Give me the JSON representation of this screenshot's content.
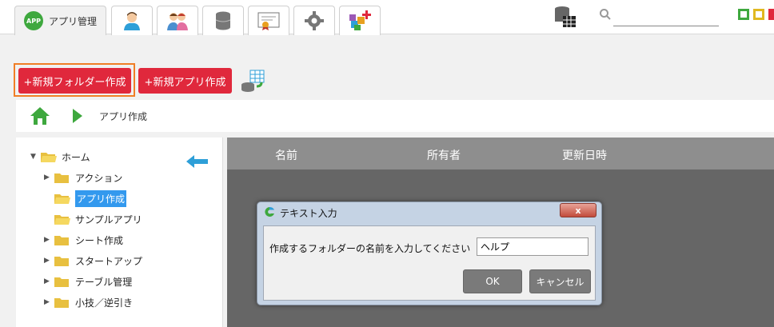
{
  "tabs": [
    {
      "label": "アプリ管理",
      "badge": "APP",
      "icon": "app-badge-icon",
      "active": true
    },
    {
      "label": "",
      "icon": "user-icon"
    },
    {
      "label": "",
      "icon": "users-icon"
    },
    {
      "label": "",
      "icon": "database-icon"
    },
    {
      "label": "",
      "icon": "certificate-icon"
    },
    {
      "label": "",
      "icon": "gear-icon"
    },
    {
      "label": "",
      "icon": "blocks-add-icon"
    }
  ],
  "search": {
    "value": "",
    "placeholder": ""
  },
  "toolbar": {
    "new_folder_label": "+新規フォルダー作成",
    "new_app_label": "+新規アプリ作成"
  },
  "breadcrumb": {
    "current": "アプリ作成"
  },
  "tree": {
    "root": "ホーム",
    "items": [
      {
        "label": "アクション",
        "expandable": true,
        "selected": false
      },
      {
        "label": "アプリ作成",
        "expandable": false,
        "selected": true
      },
      {
        "label": "サンプルアプリ",
        "expandable": false,
        "selected": false
      },
      {
        "label": "シート作成",
        "expandable": true,
        "selected": false
      },
      {
        "label": "スタートアップ",
        "expandable": true,
        "selected": false
      },
      {
        "label": "テーブル管理",
        "expandable": true,
        "selected": false
      },
      {
        "label": "小技／逆引き",
        "expandable": true,
        "selected": false
      }
    ]
  },
  "grid": {
    "columns": [
      "名前",
      "所有者",
      "更新日時"
    ]
  },
  "dialog": {
    "title": "テキスト入力",
    "close_label": "x",
    "prompt": "作成するフォルダーの名前を入力してください",
    "input_value": "ヘルプ",
    "ok_label": "OK",
    "cancel_label": "キャンセル"
  },
  "colors": {
    "accent_red": "#e0283c",
    "focus_orange": "#f07e26",
    "selection_blue": "#3399ee",
    "green": "#3ea83e"
  }
}
